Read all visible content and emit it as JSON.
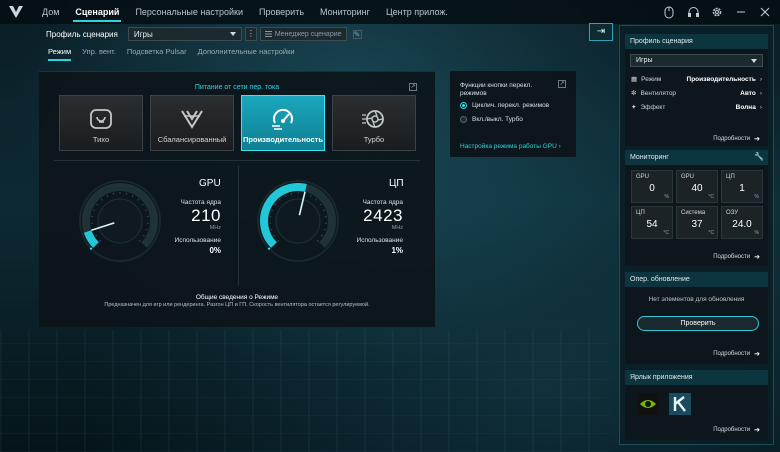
{
  "nav": {
    "items": [
      "Дом",
      "Сценарий",
      "Персональные настройки",
      "Проверить",
      "Мониторинг",
      "Центр прилож."
    ],
    "active_index": 1
  },
  "profile": {
    "label": "Профиль сценария",
    "selected": "Игры",
    "manager_label": "Менеджер сценарие"
  },
  "subtabs": [
    "Режим",
    "Упр. вент.",
    "Подсветка Pulsar",
    "Дополнительные настройки"
  ],
  "power": {
    "title": "Питание от сети пер. тока",
    "modes": [
      {
        "label": "Тихо",
        "icon": "quiet-icon"
      },
      {
        "label": "Сбалансированный",
        "icon": "balanced-icon"
      },
      {
        "label": "Производительность",
        "icon": "performance-icon"
      },
      {
        "label": "Турбо",
        "icon": "turbo-icon"
      }
    ],
    "active_mode": "Производительность"
  },
  "gpu": {
    "title": "GPU",
    "freq_label": "Частота ядра",
    "freq_value": "210",
    "freq_unit": "MHz",
    "usage_label": "Использование",
    "usage_value": "0%",
    "usage_fraction": 0.0,
    "freq_fraction": 0.1
  },
  "cpu": {
    "title": "ЦП",
    "freq_label": "Частота ядра",
    "freq_value": "2423",
    "freq_unit": "MHz",
    "usage_label": "Использование",
    "usage_value": "1%",
    "usage_fraction": 0.01,
    "freq_fraction": 0.55
  },
  "summary": {
    "title": "Общие сведения о Режиме",
    "description": "Предназначен для игр или рендеринга. Разгон ЦП и ГП. Скорость вентилятора остается регулируемой."
  },
  "mode_button": {
    "title": "Функции кнопки перекл. режимов",
    "options": [
      "Циклич. перекл. режимов",
      "Вкл./выкл. Турбо"
    ],
    "selected_index": 0,
    "gpu_link": "Настройка режима работы GPU"
  },
  "right": {
    "scenario": {
      "title": "Профиль сценария",
      "selected": "Игры",
      "rows": [
        {
          "key": "Режим",
          "value": "Производительность",
          "icon": "mode-icon"
        },
        {
          "key": "Вентилятор",
          "value": "Авто",
          "icon": "fan-icon"
        },
        {
          "key": "Эффект",
          "value": "Волна",
          "icon": "effect-icon"
        }
      ],
      "more": "Подробности"
    },
    "monitoring": {
      "title": "Мониторинг",
      "tiles": [
        {
          "key": "GPU",
          "value": "0",
          "unit": "%"
        },
        {
          "key": "GPU",
          "value": "40",
          "unit": "°C"
        },
        {
          "key": "ЦП",
          "value": "1",
          "unit": "%"
        },
        {
          "key": "ЦП",
          "value": "54",
          "unit": "°C"
        },
        {
          "key": "Система",
          "value": "37",
          "unit": "°C"
        },
        {
          "key": "ОЗУ",
          "value": "24.0",
          "unit": "%"
        }
      ],
      "more": "Подробности"
    },
    "update": {
      "title": "Опер. обновление",
      "empty": "Нет элементов для обновления",
      "check": "Проверить",
      "more": "Подробности"
    },
    "shortcuts": {
      "title": "Ярлык приложения",
      "apps": [
        "nvidia-icon",
        "killer-icon"
      ],
      "more": "Подробности"
    }
  },
  "colors": {
    "accent": "#2fd3e0",
    "active_mode": "#1aa7bd"
  }
}
